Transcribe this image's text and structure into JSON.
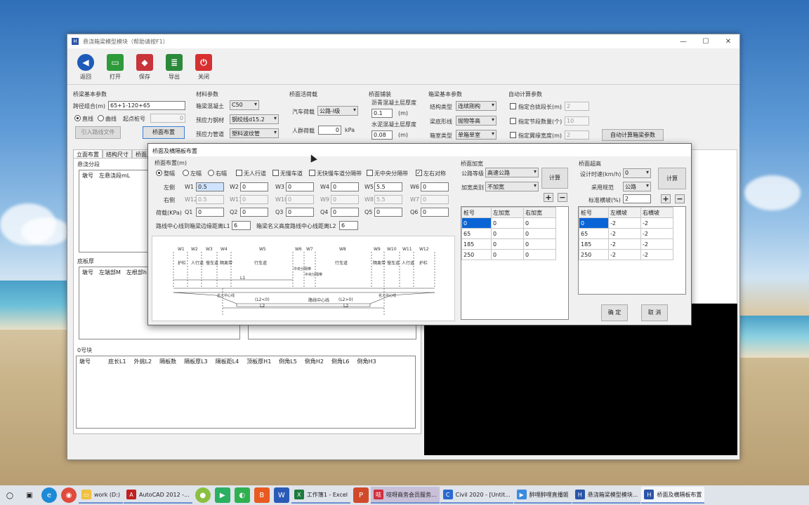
{
  "window": {
    "title": "悬浇箱梁模型模块（帮助请按F1）"
  },
  "toolbar": [
    {
      "label": "返回",
      "icon": "back-arrow-icon",
      "color": "#1e5bb8"
    },
    {
      "label": "打开",
      "icon": "folder-open-icon",
      "color": "#2e9a3a"
    },
    {
      "label": "保存",
      "icon": "save-icon",
      "color": "#c8343a"
    },
    {
      "label": "导出",
      "icon": "export-icon",
      "color": "#2a8a3a"
    },
    {
      "label": "关闭",
      "icon": "power-icon",
      "color": "#d83030"
    }
  ],
  "basic": {
    "title": "桥梁基本参数",
    "span_label": "跨径组合(m)",
    "span_value": "65+1-120+65",
    "radio_straight": "直线",
    "radio_curve": "曲线",
    "start_pile_label": "起点桩号",
    "start_pile_value": "0",
    "import_btn": "引入路线文件",
    "deck_btn": "桥面布置"
  },
  "material": {
    "title": "材料参数",
    "concrete_label": "箱梁混凝土",
    "concrete_value": "C50",
    "strand_label": "预应力钢材",
    "strand_value": "钢绞线d15.2",
    "duct_label": "预应力管道",
    "duct_value": "塑料波纹管"
  },
  "load": {
    "title": "桥面活荷载",
    "vehicle_label": "汽车荷载",
    "vehicle_value": "公路-I级",
    "crowd_label": "人群荷载",
    "crowd_value": "0",
    "crowd_unit": "kPa"
  },
  "pavement": {
    "title": "桥面铺装",
    "asphalt_label": "沥青混凝土层厚度",
    "asphalt_value": "0.1",
    "asphalt_unit": "(m)",
    "cement_label": "水泥混凝土层厚度",
    "cement_value": "0.08",
    "cement_unit": "(m)"
  },
  "boxbasic": {
    "title": "箱梁基本参数",
    "struct_label": "结构类型",
    "struct_value": "连续刚构",
    "bottom_label": "梁底形线",
    "bottom_value": "抛物等高",
    "section_label": "箱室类型",
    "section_value": "单箱单室"
  },
  "autocalc": {
    "title": "自动计算参数",
    "opt1": "指定合拢段长(m)",
    "opt1_value": "2",
    "opt2": "指定节段数量(个)",
    "opt2_value": "10",
    "opt3": "指定翼缘宽度(m)",
    "opt3_value": "2",
    "btn": "自动计算箱梁参数"
  },
  "lower": {
    "tabs": [
      "立面布置",
      "结构尺寸",
      "桥面尺寸"
    ],
    "group1_title": "悬浇分段",
    "grid1_headers": [
      "墩号",
      "左悬浇段mL"
    ],
    "group2_title": "底板厚",
    "grid2_headers": [
      "墩号",
      "左端部M",
      "左根部h"
    ],
    "group3_title": "0号块",
    "grid3_headers": [
      "墩号",
      "底长L1",
      "外挑L2",
      "隔板数",
      "隔板厚L3",
      "隔板距L4",
      "顶板厚H1",
      "倒角L5",
      "倒角H2",
      "倒角L6",
      "倒角H3"
    ]
  },
  "dialog": {
    "title": "桥面及横隔板布置",
    "layout_title": "桥面布置(m)",
    "opts": {
      "whole": "整幅",
      "left": "左幅",
      "right": "右幅",
      "no_sidewalk": "无人行道",
      "no_slow": "无慢车道",
      "no_fastslow_sep": "无快慢车道分隔带",
      "no_median": "无中央分隔带",
      "symmetric": "左右对称"
    },
    "left_label": "左侧",
    "right_label": "右侧",
    "load_label": "荷载(KPa)",
    "w_left": [
      {
        "k": "W1",
        "v": "0.5"
      },
      {
        "k": "W2",
        "v": "0"
      },
      {
        "k": "W3",
        "v": "0"
      },
      {
        "k": "W4",
        "v": "0"
      },
      {
        "k": "W5",
        "v": "5.5"
      },
      {
        "k": "W6",
        "v": "0"
      }
    ],
    "w_right": [
      {
        "k": "W12",
        "v": "0.5"
      },
      {
        "k": "W11",
        "v": "0"
      },
      {
        "k": "W10",
        "v": "0"
      },
      {
        "k": "W9",
        "v": "0"
      },
      {
        "k": "W8",
        "v": "5.5"
      },
      {
        "k": "W7",
        "v": "0"
      }
    ],
    "q": [
      {
        "k": "Q1",
        "v": "0"
      },
      {
        "k": "Q2",
        "v": "0"
      },
      {
        "k": "Q3",
        "v": "0"
      },
      {
        "k": "Q4",
        "v": "0"
      },
      {
        "k": "Q5",
        "v": "0"
      },
      {
        "k": "Q6",
        "v": "0"
      }
    ],
    "l1_label": "路线中心线到箱梁边缘距离L1",
    "l1_value": "6",
    "l2_label": "箱梁名义高度路线中心线距离L2",
    "l2_value": "6",
    "diagram": {
      "w_labels": [
        "W1",
        "W2",
        "W3",
        "W4",
        "W5",
        "W6",
        "W7",
        "W8",
        "W9",
        "W10",
        "W11",
        "W12"
      ],
      "lanes": [
        "护栏",
        "人行道",
        "慢车道",
        "隔离带",
        "行车道",
        "中央分隔带",
        "中央分隔带",
        "行车道",
        "隔离带",
        "慢车道",
        "人行道",
        "护栏"
      ],
      "l1": "L1",
      "l2_left": "(L2<0)",
      "l2_right": "(L2>0)",
      "l2a": "L2",
      "l2b": "L2",
      "center": "路线中心线",
      "nominal_left": "名义中心线",
      "nominal_right": "名义中心线"
    },
    "widen": {
      "title": "桥面加宽",
      "grade_label": "公路等级",
      "grade_value": "高速公路",
      "type_label": "加宽类别",
      "type_value": "不加宽",
      "calc_btn": "计算",
      "headers": [
        "桩号",
        "左加宽",
        "右加宽"
      ],
      "rows": [
        [
          "0",
          "0",
          "0"
        ],
        [
          "65",
          "0",
          "0"
        ],
        [
          "185",
          "0",
          "0"
        ],
        [
          "250",
          "0",
          "0"
        ]
      ]
    },
    "super": {
      "title": "桥面超高",
      "speed_label": "设计时速(km/h)",
      "speed_value": "0",
      "code_label": "采用规范",
      "code_value": "公路",
      "slope_label": "标准横坡(%)",
      "slope_value": "2",
      "calc_btn": "计算",
      "headers": [
        "桩号",
        "左横坡",
        "右横坡"
      ],
      "rows": [
        [
          "0",
          "-2",
          "-2"
        ],
        [
          "65",
          "-2",
          "-2"
        ],
        [
          "185",
          "-2",
          "-2"
        ],
        [
          "250",
          "-2",
          "-2"
        ]
      ]
    },
    "ok": "确 定",
    "cancel": "取 消"
  },
  "taskbar": {
    "apps": [
      "work (D:)",
      "AutoCAD 2012 -...",
      "工作簿1 - Excel",
      "吱呀商务会员服务...",
      "Civil 2020 - [Untit...",
      "醉哩醉哩直播姬",
      "悬浇箱梁模型模块...",
      "桥面及横隔板布置"
    ]
  }
}
